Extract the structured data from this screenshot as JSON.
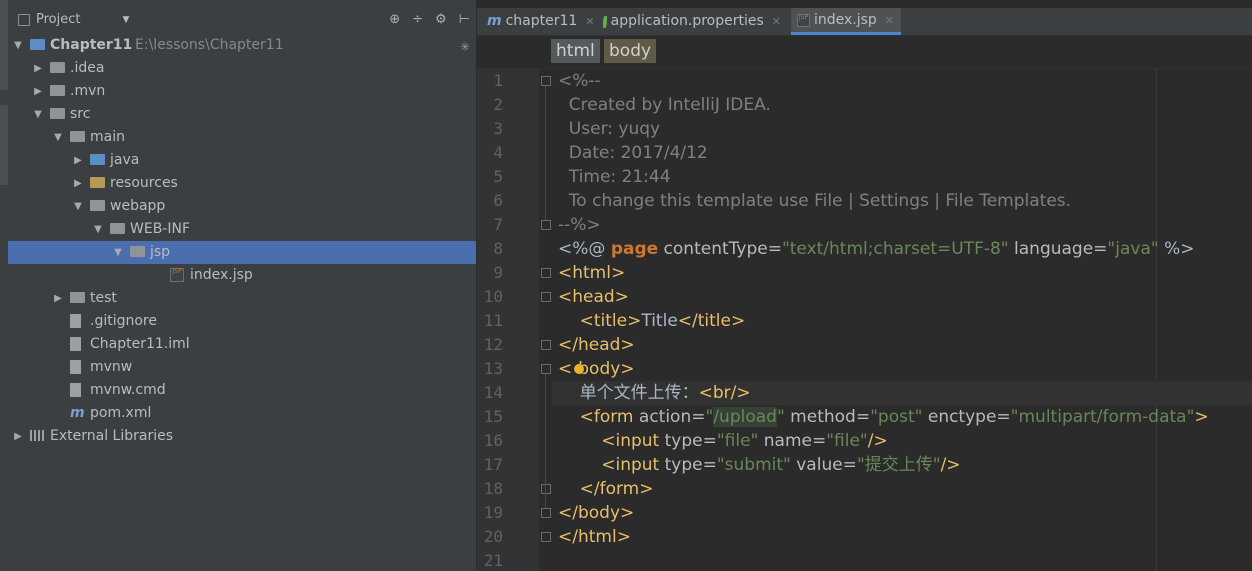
{
  "project_panel": {
    "title": "Project",
    "tools": [
      "⊕",
      "÷",
      "⚙",
      "⊢"
    ],
    "tree": [
      {
        "label": "Chapter11",
        "path": "E:\\lessons\\Chapter11",
        "depth": 0,
        "arrow": "down",
        "icon": "module-folder",
        "bold": true
      },
      {
        "label": ".idea",
        "depth": 1,
        "arrow": "right",
        "icon": "folder"
      },
      {
        "label": ".mvn",
        "depth": 1,
        "arrow": "right",
        "icon": "folder"
      },
      {
        "label": "src",
        "depth": 1,
        "arrow": "down",
        "icon": "folder"
      },
      {
        "label": "main",
        "depth": 2,
        "arrow": "down",
        "icon": "folder"
      },
      {
        "label": "java",
        "depth": 3,
        "arrow": "right",
        "icon": "source-folder"
      },
      {
        "label": "resources",
        "depth": 3,
        "arrow": "right",
        "icon": "resources-folder"
      },
      {
        "label": "webapp",
        "depth": 3,
        "arrow": "down",
        "icon": "folder"
      },
      {
        "label": "WEB-INF",
        "depth": 4,
        "arrow": "down",
        "icon": "folder"
      },
      {
        "label": "jsp",
        "depth": 5,
        "arrow": "down",
        "icon": "folder",
        "selected": true
      },
      {
        "label": "index.jsp",
        "depth": 7,
        "arrow": "none",
        "icon": "jsp-file"
      },
      {
        "label": "test",
        "depth": 2,
        "arrow": "right",
        "icon": "folder"
      },
      {
        "label": ".gitignore",
        "depth": 2,
        "arrow": "none",
        "icon": "file"
      },
      {
        "label": "Chapter11.iml",
        "depth": 2,
        "arrow": "none",
        "icon": "file"
      },
      {
        "label": "mvnw",
        "depth": 2,
        "arrow": "none",
        "icon": "file"
      },
      {
        "label": "mvnw.cmd",
        "depth": 2,
        "arrow": "none",
        "icon": "file"
      },
      {
        "label": "pom.xml",
        "depth": 2,
        "arrow": "none",
        "icon": "maven"
      },
      {
        "label": "External Libraries",
        "depth": 0,
        "arrow": "right",
        "icon": "libraries"
      }
    ]
  },
  "tabs": [
    {
      "label": "chapter11",
      "icon": "m"
    },
    {
      "label": "application.properties",
      "icon": "leaf"
    },
    {
      "label": "index.jsp",
      "icon": "jsp",
      "active": true
    }
  ],
  "breadcrumbs": [
    "html",
    "body"
  ],
  "line_numbers": [
    "1",
    "2",
    "3",
    "4",
    "5",
    "6",
    "7",
    "8",
    "9",
    "10",
    "11",
    "12",
    "13",
    "14",
    "15",
    "16",
    "17",
    "18",
    "19",
    "20",
    "21"
  ],
  "code": {
    "l1": "<%--",
    "l2": "  Created by IntelliJ IDEA.",
    "l3": "  User: yuqy",
    "l4": "  Date: 2017/4/12",
    "l5": "  Time: 21:44",
    "l6": "  To change this template use File | Settings | File Templates.",
    "l7": "--%>",
    "l8_open": "<%@ ",
    "l8_kw": "page",
    "l8_a1": " contentType=",
    "l8_v1": "\"text/html;charset=UTF-8\"",
    "l8_a2": " language=",
    "l8_v2": "\"java\"",
    "l8_close": " %>",
    "l9": "<html>",
    "l10": "<head>",
    "l11_o": "    <title>",
    "l11_t": "Title",
    "l11_c": "</title>",
    "l12": "</head>",
    "l13_a": "<",
    "l13_b": "body>",
    "l14_t": "    单个文件上传：",
    "l14_tag": "<br/>",
    "l15_o": "    <form",
    "l15_a1": " action=",
    "l15_q1": "\"",
    "l15_v1": "/upload",
    "l15_q1e": "\"",
    "l15_a2": " method=",
    "l15_v2": "\"post\"",
    "l15_a3": " enctype=",
    "l15_v3": "\"multipart/form-data\"",
    "l15_c": ">",
    "l16_o": "        <input",
    "l16_a1": " type=",
    "l16_v1": "\"file\"",
    "l16_a2": " name=",
    "l16_v2": "\"file\"",
    "l16_c": "/>",
    "l17_o": "        <input",
    "l17_a1": " type=",
    "l17_v1": "\"submit\"",
    "l17_a2": " value=",
    "l17_v2": "\"提交上传\"",
    "l17_c": "/>",
    "l18": "    </form>",
    "l19": "</body>",
    "l20": "</html>"
  }
}
